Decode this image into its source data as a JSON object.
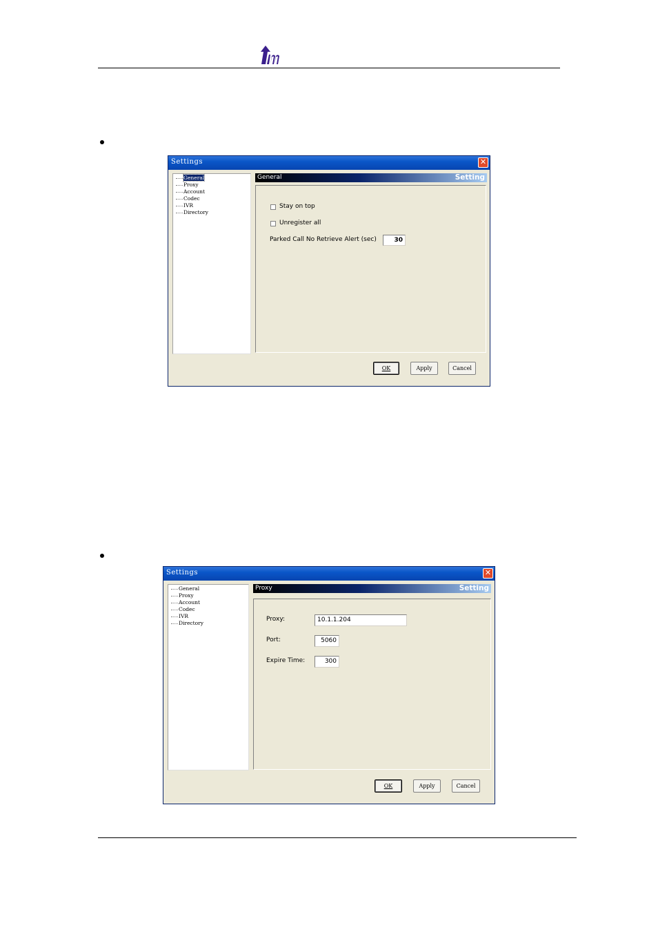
{
  "colors": {
    "logo": "#3b1f8c",
    "titlebar": "#0a56c8",
    "dialog_bg": "#ece9d8",
    "close": "#e04a2a"
  },
  "dialog1": {
    "title": "Settings",
    "tree": [
      "General",
      "Proxy",
      "Account",
      "Codec",
      "IVR",
      "Directory"
    ],
    "selected": "General",
    "header_left": "General",
    "header_right": "Setting",
    "stay_on_top": "Stay on top",
    "unregister_all": "Unregister all",
    "parked_label": "Parked Call No Retrieve Alert (sec)",
    "parked_value": "30",
    "ok_label": "OK",
    "apply_label": "Apply",
    "cancel_label": "Cancel"
  },
  "dialog2": {
    "title": "Settings",
    "tree": [
      "General",
      "Proxy",
      "Account",
      "Codec",
      "IVR",
      "Directory"
    ],
    "selected": "Proxy",
    "header_left": "Proxy",
    "header_right": "Setting",
    "proxy_label": "Proxy:",
    "proxy_value": "10.1.1.204",
    "port_label": "Port:",
    "port_value": "5060",
    "expire_label": "Expire Time:",
    "expire_value": "300",
    "ok_label": "OK",
    "apply_label": "Apply",
    "cancel_label": "Cancel"
  }
}
